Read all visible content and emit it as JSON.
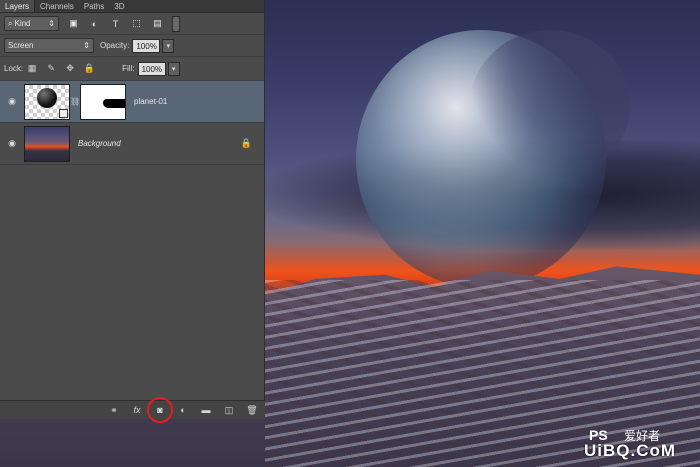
{
  "tabs": [
    {
      "label": "Layers",
      "active": true
    },
    {
      "label": "Channels",
      "active": false
    },
    {
      "label": "Paths",
      "active": false
    },
    {
      "label": "3D",
      "active": false
    }
  ],
  "filter": {
    "kind_label": "Kind"
  },
  "blend": {
    "mode": "Screen",
    "opacity_label": "Opacity:",
    "opacity_value": "100%"
  },
  "lock": {
    "label": "Lock:",
    "fill_label": "Fill:",
    "fill_value": "100%"
  },
  "layers": [
    {
      "name": "planet-01",
      "selected": true,
      "italic": false
    },
    {
      "name": "Background",
      "selected": false,
      "italic": true
    }
  ],
  "watermark": {
    "ps": "PS",
    "cn": "爱好者",
    "url": "UiBQ.CoM"
  },
  "colors": {
    "panel_bg": "#4b4b4b",
    "selection": "#596675",
    "highlight_circle": "#e02020"
  }
}
